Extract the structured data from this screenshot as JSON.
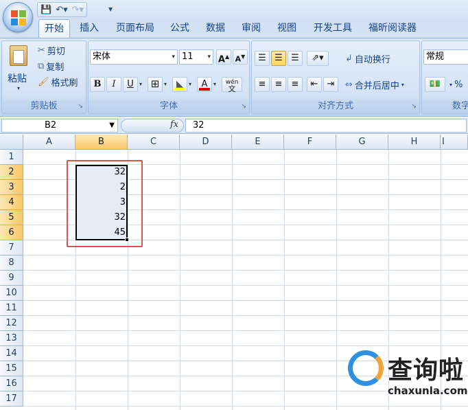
{
  "quick_access": {
    "save_icon": "save-icon",
    "undo_icon": "undo-icon",
    "redo_icon": "redo-icon",
    "customize_icon": "customize-icon"
  },
  "tabs": [
    "开始",
    "插入",
    "页面布局",
    "公式",
    "数据",
    "审阅",
    "视图",
    "开发工具",
    "福昕阅读器"
  ],
  "active_tab": "开始",
  "clipboard": {
    "paste": "粘贴",
    "cut": "剪切",
    "copy": "复制",
    "format_painter": "格式刷",
    "group_label": "剪贴板"
  },
  "font": {
    "font_name": "宋体",
    "font_size": "11",
    "grow": "A",
    "shrink": "A",
    "bold": "B",
    "italic": "I",
    "underline": "U",
    "font_color_glyph": "A",
    "phonetic_glyph": "wén",
    "group_label": "字体"
  },
  "alignment": {
    "wrap_text": "自动换行",
    "merge_center": "合并后居中",
    "group_label": "对齐方式"
  },
  "number": {
    "format": "常规",
    "percent": "%",
    "group_label": "数字"
  },
  "formula_bar": {
    "name_box": "B2",
    "fx": "fx",
    "content": "32"
  },
  "columns": [
    "A",
    "B",
    "C",
    "D",
    "E",
    "F",
    "G",
    "H",
    "I"
  ],
  "active_column": "B",
  "rows": [
    "1",
    "2",
    "3",
    "4",
    "5",
    "6",
    "7",
    "8",
    "9",
    "10",
    "11",
    "12",
    "13",
    "14",
    "15",
    "16",
    "17"
  ],
  "active_rows": [
    "2",
    "3",
    "4",
    "5",
    "6"
  ],
  "cells": {
    "B2": "32",
    "B3": "2",
    "B4": "3",
    "B5": "32",
    "B6": "45"
  },
  "watermark": {
    "text": "查询啦",
    "sub": "chaxunla.com"
  },
  "colors": {
    "highlight_box": "#d9534f",
    "selection_fill": "#e7ebf6",
    "ribbon_blue": "#c9dcf2"
  }
}
